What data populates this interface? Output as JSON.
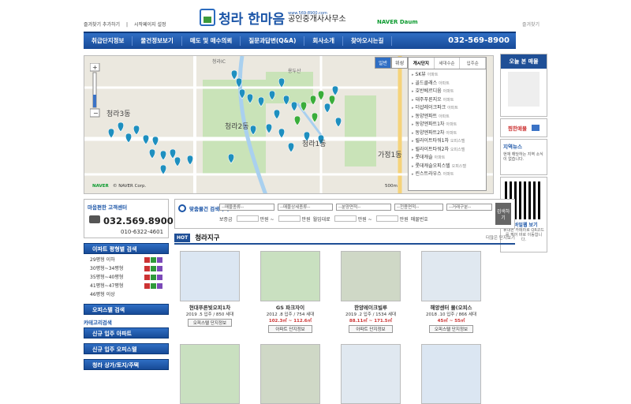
{
  "header": {
    "bookmark_label": "즐겨찾기 추가하기",
    "start_label": "시작페이지 설정",
    "brand": "청라 한마음",
    "url": "www.569-8900.com",
    "office": "공인중개사사무소",
    "naver": "NAVER Daum",
    "right_label": "즐겨찾기"
  },
  "nav": {
    "items": [
      "취급단지정보",
      "물건정보보기",
      "매도 및 매수의뢰",
      "질문과답변(Q&A)",
      "회사소개",
      "찾아오시는길"
    ],
    "phone": "032-569-8900"
  },
  "map": {
    "tabs": [
      "일반",
      "위성"
    ],
    "labels": [
      "청라3동",
      "청라2동",
      "청라1동",
      "가정1동",
      "청라IC",
      "용두산",
      "NAVER",
      "© NAVER Corp.",
      "500m"
    ],
    "complex_tabs": [
      "개시단지",
      "세대수순",
      "입주순"
    ],
    "complex_list": [
      [
        "SK뷰",
        "아파트"
      ],
      [
        "골드클래스",
        "아파트"
      ],
      [
        "호반베르디움",
        "아파트"
      ],
      [
        "대주푸른지오",
        "아파트"
      ],
      [
        "더샵레이크파크",
        "아파트"
      ],
      [
        "동양엔파트",
        "아파트"
      ],
      [
        "동양엔파트1차",
        "아파트"
      ],
      [
        "동양엔파트2차",
        "아파트"
      ],
      [
        "릴라이트타워1차",
        "오피스텔"
      ],
      [
        "릴라이트타워2차",
        "오피스텔"
      ],
      [
        "롯데캐슬",
        "아파트"
      ],
      [
        "롯데캐슬오피스텔",
        "오피스텔"
      ],
      [
        "린스트라우스",
        "아파트"
      ]
    ]
  },
  "right": {
    "today_title": "오늘 본 매물",
    "fav_label": "찜한매물",
    "news_title": "지역뉴스",
    "news_text": "현재 해당하는 지역 소식이 없습니다.",
    "mobile_title": "모바일웹 보기",
    "mobile_text": "휴대폰 카메라로 QR코드를 찍어 바로 이동합니다."
  },
  "search": {
    "title": "맞춤물건 검색하기",
    "selects": [
      "--매물종류--",
      "--매물상세종류--",
      "--분양면적--",
      "--전용면적--",
      "--거래구분--"
    ],
    "row2": [
      "보증금",
      "만원 ~",
      "만원",
      "월임대료",
      "만원 ~",
      "만원",
      "매물번호"
    ],
    "button": "검색하기"
  },
  "contact": {
    "title": "마음편한 고객센터",
    "phone": "032.569.8900",
    "mobile": "010-6322-4601"
  },
  "left": {
    "pyeong_title": "이파트 평형별 검색",
    "pyeong_list": [
      "29평형 이하",
      "30평형~34평형",
      "35평형~40평형",
      "41평형~47평형",
      "46평형 이상"
    ],
    "officetel_title": "오피스텔 검색",
    "category_title": "카테고리검색",
    "btn1": "신규 입주 아파트",
    "btn2": "신규 입주 오피스텔",
    "btn3": "청라 상가/토지/주택"
  },
  "listing": {
    "hot": "HOT",
    "title": "청라지구",
    "more": "더많은 단지보기",
    "cards": [
      {
        "name": "현대푸른빛오피1차",
        "info": "2019 .5 입주 / 850 세대",
        "price": "",
        "btn": "오피스텔 단지정보"
      },
      {
        "name": "GS 파크자이",
        "info": "2012 .8 입주 / 754 세대",
        "price": "102.3㎡ ~ 112.6㎡",
        "btn": "아파트 단지정보"
      },
      {
        "name": "한양레이크빌루",
        "info": "2019 .2 입주 / 1534 세대",
        "price": "88.11㎡ ~ 171.5㎡",
        "btn": "아파트 단지정보"
      },
      {
        "name": "해양센터 몰(오피스",
        "info": "2018 .10 입주 / 866 세대",
        "price": "45㎡ ~ 55㎡",
        "btn": "오피스텔 단지정보"
      }
    ]
  }
}
